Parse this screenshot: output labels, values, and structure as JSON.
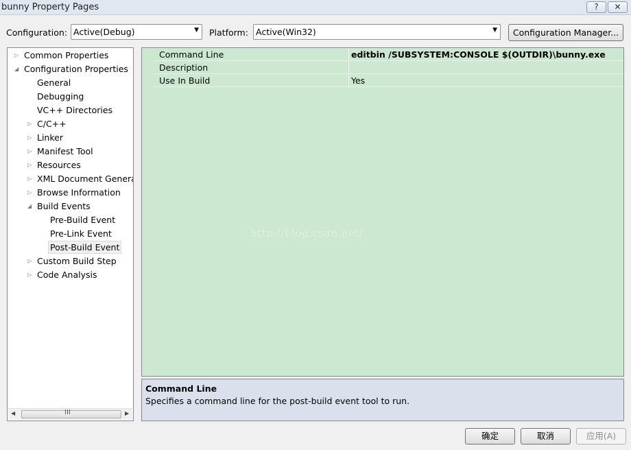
{
  "window": {
    "title": "bunny Property Pages",
    "help_glyph": "?",
    "close_glyph": "✕"
  },
  "toolbar": {
    "configuration_label": "Configuration:",
    "configuration_value": "Active(Debug)",
    "platform_label": "Platform:",
    "platform_value": "Active(Win32)",
    "config_manager_label": "Configuration Manager..."
  },
  "tree": {
    "items": [
      {
        "label": "Common Properties",
        "toggle": "▷"
      },
      {
        "label": "Configuration Properties",
        "toggle": "◢"
      },
      {
        "label": "General"
      },
      {
        "label": "Debugging"
      },
      {
        "label": "VC++ Directories"
      },
      {
        "label": "C/C++",
        "toggle": "▷"
      },
      {
        "label": "Linker",
        "toggle": "▷"
      },
      {
        "label": "Manifest Tool",
        "toggle": "▷"
      },
      {
        "label": "Resources",
        "toggle": "▷"
      },
      {
        "label": "XML Document Generat",
        "toggle": "▷"
      },
      {
        "label": "Browse Information",
        "toggle": "▷"
      },
      {
        "label": "Build Events",
        "toggle": "◢"
      },
      {
        "label": "Pre-Build Event"
      },
      {
        "label": "Pre-Link Event"
      },
      {
        "label": "Post-Build Event",
        "selected": true
      },
      {
        "label": "Custom Build Step",
        "toggle": "▷"
      },
      {
        "label": "Code Analysis",
        "toggle": "▷"
      }
    ],
    "scroll_left_glyph": "◀",
    "scroll_right_glyph": "▶",
    "scroll_grip": "III"
  },
  "grid": {
    "rows": [
      {
        "name": "Command Line",
        "value": "editbin /SUBSYSTEM:CONSOLE $(OUTDIR)\\bunny.exe"
      },
      {
        "name": "Description",
        "value": ""
      },
      {
        "name": "Use In Build",
        "value": "Yes"
      }
    ]
  },
  "watermark": "http://blog.csdn.net/",
  "description": {
    "title": "Command Line",
    "text": "Specifies a command line for the post-build event tool to run."
  },
  "buttons": {
    "ok": "确定",
    "cancel": "取消",
    "apply": "应用(A)"
  },
  "colors": {
    "grid_background": "#cde8d1",
    "description_background": "#dbe1ec"
  }
}
